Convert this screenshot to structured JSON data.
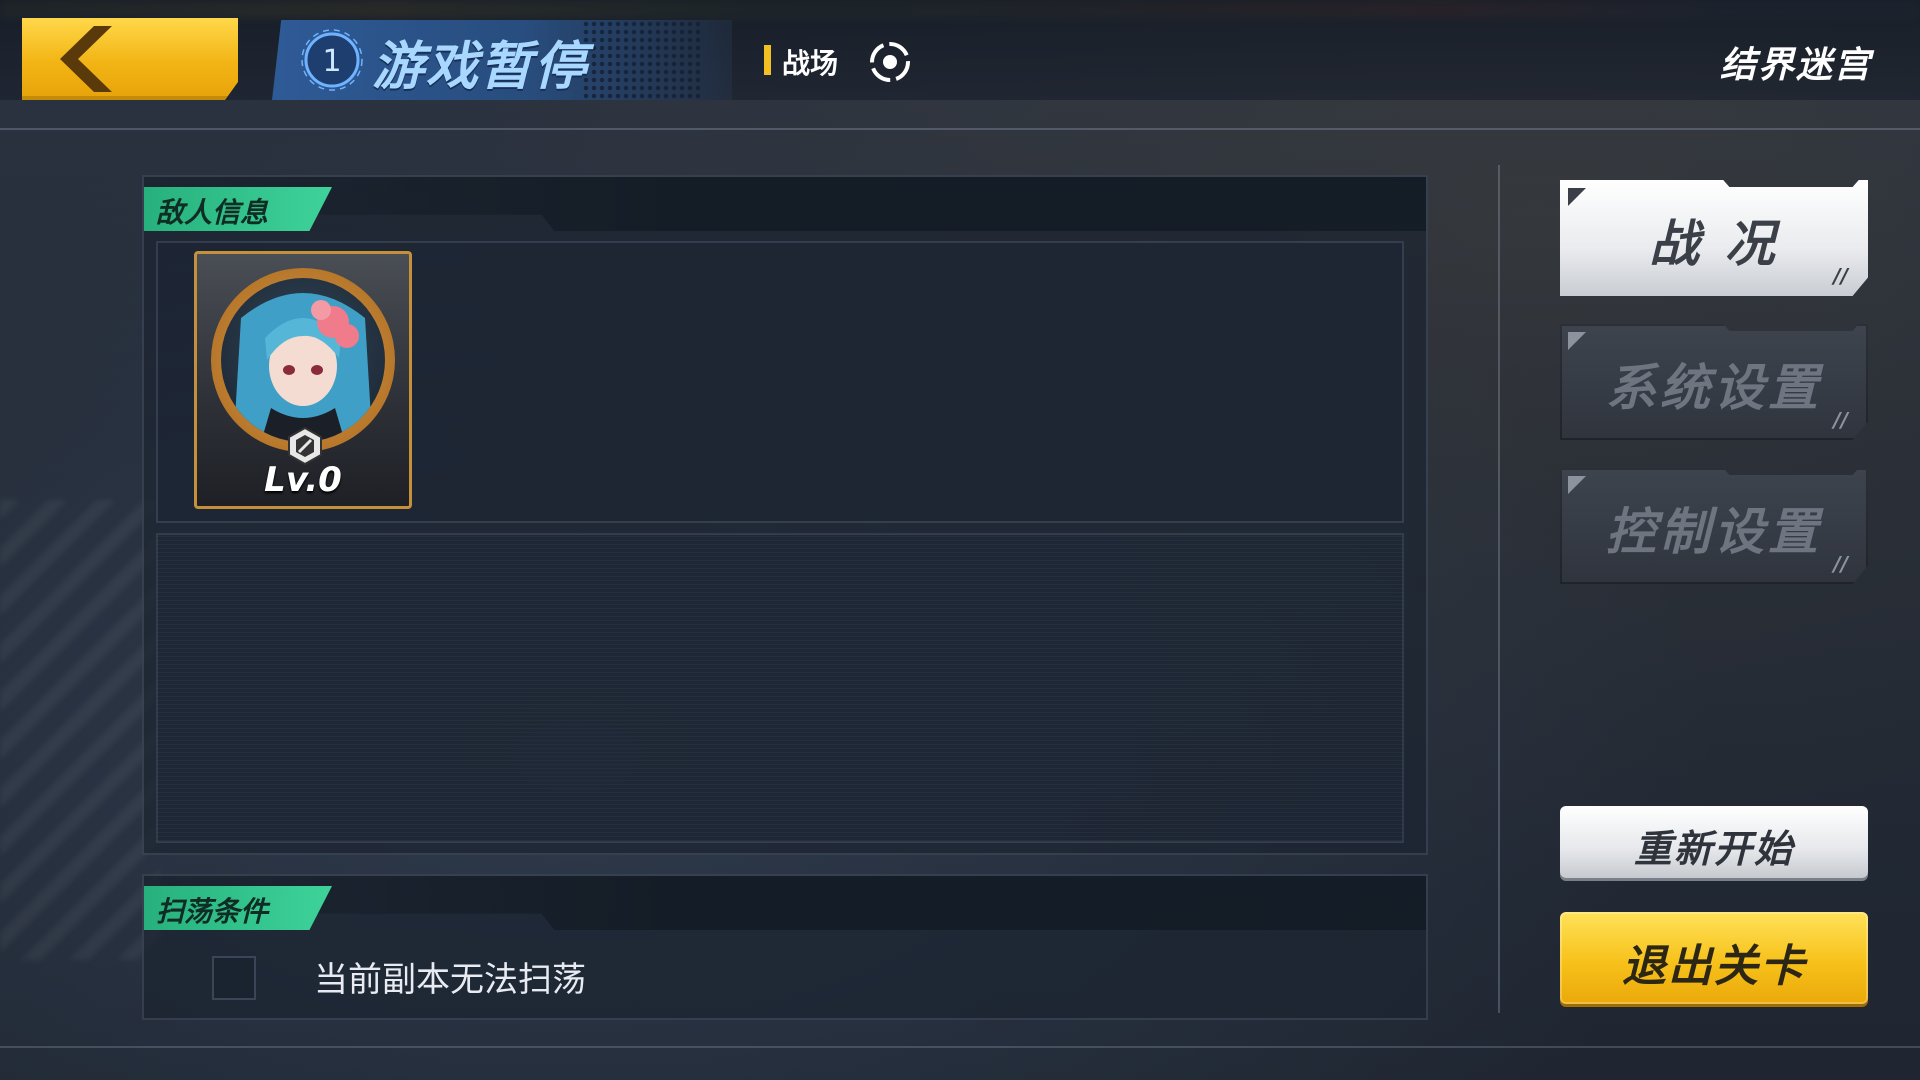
{
  "header": {
    "pause_badge_number": "1",
    "title": "游戏暂停",
    "mode_label": "战场",
    "stage_name": "结界迷宫"
  },
  "enemy_panel": {
    "tag": "敌人信息",
    "enemies": [
      {
        "level": "Lv.0",
        "icon": "character-portrait"
      }
    ]
  },
  "sweep_panel": {
    "tag": "扫荡条件",
    "condition_text": "当前副本无法扫荡"
  },
  "menu": {
    "battle_status": "战 况",
    "system_settings": "系统设置",
    "control_settings": "控制设置",
    "restart": "重新开始",
    "exit_stage": "退出关卡"
  },
  "colors": {
    "accent_yellow": "#f2b414",
    "tag_green": "#3ed39a",
    "title_blue": "#a8d8ff"
  }
}
